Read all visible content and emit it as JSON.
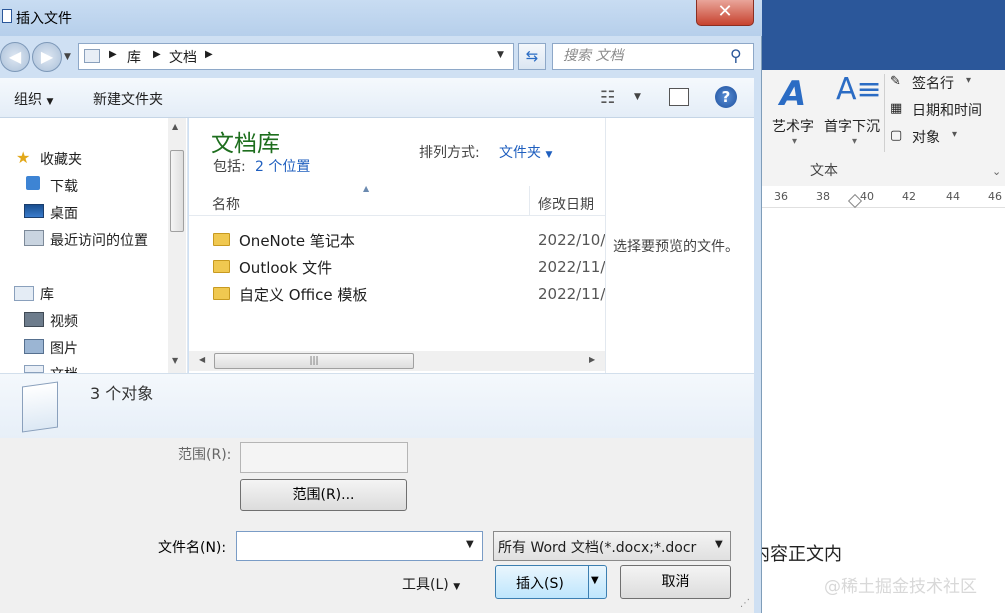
{
  "dialog": {
    "title": "插入文件",
    "close": "✕",
    "address": {
      "crumbs": [
        "库",
        "文档"
      ]
    },
    "search_placeholder": "搜索 文档",
    "toolbar": {
      "organize": "组织",
      "new_folder": "新建文件夹"
    },
    "nav": {
      "favorites": "收藏夹",
      "downloads": "下载",
      "desktop": "桌面",
      "recent": "最近访问的位置",
      "libraries": "库",
      "videos": "视频",
      "pictures": "图片",
      "docs": "文档"
    },
    "library": {
      "title": "文档库",
      "includes_label": "包括:",
      "includes_value": "2 个位置",
      "arrange_label": "排列方式:",
      "arrange_value": "文件夹"
    },
    "columns": {
      "name": "名称",
      "modified": "修改日期"
    },
    "files": [
      {
        "name": "OneNote 笔记本",
        "date": "2022/10/"
      },
      {
        "name": "Outlook 文件",
        "date": "2022/11/"
      },
      {
        "name": "自定义 Office 模板",
        "date": "2022/11/"
      }
    ],
    "preview_text": "选择要预览的文件。",
    "details_text": "3 个对象",
    "range_label": "范围(R):",
    "range_button": "范围(R)...",
    "filename_label": "文件名(N):",
    "filename_value": "",
    "filetype": "所有 Word 文档(*.docx;*.docr",
    "tools": "工具(L)",
    "insert": "插入(S)",
    "cancel": "取消"
  },
  "word": {
    "ribbon": {
      "wordart": "艺术字",
      "dropcap": "首字下沉",
      "signature": "签名行",
      "datetime": "日期和时间",
      "object": "对象",
      "group_text": "文本"
    },
    "ruler": [
      "36",
      "38",
      "40",
      "42",
      "44",
      "46"
    ],
    "doc_text": "内容正文内",
    "watermark": "@稀土掘金技术社区"
  },
  "colors": {
    "accent": "#2b579a",
    "library_title": "#1e6e1e",
    "link": "#1f5fbf"
  }
}
